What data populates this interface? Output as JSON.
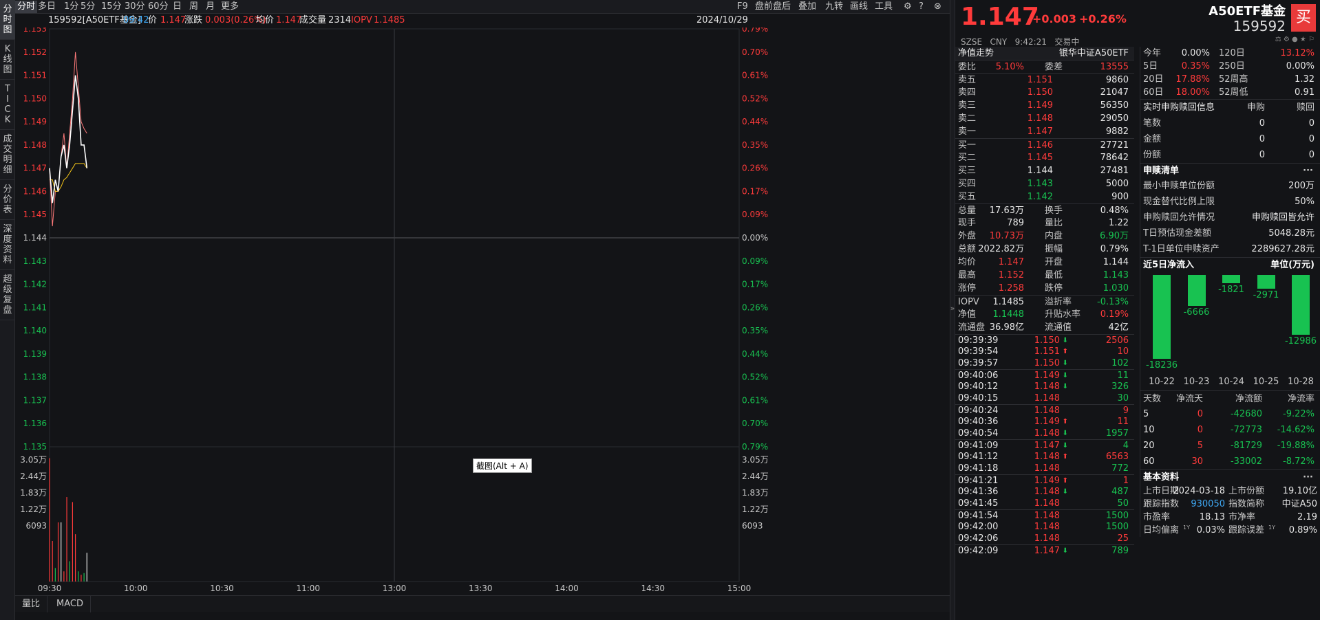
{
  "left_tabs": [
    "分时图",
    "K线图",
    "TICK",
    "成交明细",
    "分价表",
    "深度资料",
    "超级复盘"
  ],
  "toolbar": {
    "periods": [
      "分时",
      "多日",
      "1分",
      "5分",
      "15分",
      "30分",
      "60分",
      "日",
      "周",
      "月",
      "更多"
    ],
    "right_items": [
      "F9",
      "盘前盘后",
      "叠加",
      "九转",
      "画线",
      "工具"
    ],
    "icons": [
      "gear-icon",
      "help-icon",
      "close-icon"
    ]
  },
  "infobar": {
    "code_name": "159592[A50ETF基金]",
    "time": "09:42",
    "price_label": "价",
    "price": "1.147",
    "change_label": "涨跌",
    "change": "0.003(0.26%)",
    "avg_label": "均价",
    "avg": "1.147",
    "vol_label": "成交量",
    "vol": "2314",
    "iopv_label": "IOPV",
    "iopv": "1.1485",
    "date": "2024/10/29"
  },
  "chart_data": {
    "type": "line",
    "prev_close": 1.144,
    "price_ticks": [
      "1.153",
      "1.152",
      "1.151",
      "1.150",
      "1.149",
      "1.148",
      "1.147",
      "1.146",
      "1.145",
      "1.144",
      "1.143",
      "1.142",
      "1.141",
      "1.140",
      "1.139",
      "1.138",
      "1.137",
      "1.136",
      "1.135"
    ],
    "pct_ticks": [
      "0.79%",
      "0.70%",
      "0.61%",
      "0.52%",
      "0.44%",
      "0.35%",
      "0.26%",
      "0.17%",
      "0.09%",
      "0.00%",
      "0.09%",
      "0.17%",
      "0.26%",
      "0.35%",
      "0.44%",
      "0.52%",
      "0.61%",
      "0.70%",
      "0.79%"
    ],
    "vol_ticks": [
      "3.05万",
      "2.44万",
      "1.83万",
      "1.22万",
      "6093"
    ],
    "time_ticks": [
      "09:30",
      "10:00",
      "10:30",
      "11:00",
      "13:00",
      "13:30",
      "14:00",
      "14:30",
      "15:00"
    ],
    "price_series": [
      {
        "t": 0,
        "v": 1.147
      },
      {
        "t": 1,
        "v": 1.1455
      },
      {
        "t": 2,
        "v": 1.1465
      },
      {
        "t": 3,
        "v": 1.146
      },
      {
        "t": 4,
        "v": 1.1475
      },
      {
        "t": 5,
        "v": 1.148
      },
      {
        "t": 6,
        "v": 1.147
      },
      {
        "t": 7,
        "v": 1.148
      },
      {
        "t": 8,
        "v": 1.1495
      },
      {
        "t": 9,
        "v": 1.151
      },
      {
        "t": 10,
        "v": 1.15
      },
      {
        "t": 11,
        "v": 1.148
      },
      {
        "t": 12,
        "v": 1.148
      },
      {
        "t": 13,
        "v": 1.147
      }
    ],
    "avg_series": [
      {
        "t": 0,
        "v": 1.1465
      },
      {
        "t": 1,
        "v": 1.1465
      },
      {
        "t": 2,
        "v": 1.146
      },
      {
        "t": 3,
        "v": 1.146
      },
      {
        "t": 4,
        "v": 1.1462
      },
      {
        "t": 5,
        "v": 1.1465
      },
      {
        "t": 6,
        "v": 1.1466
      },
      {
        "t": 7,
        "v": 1.1468
      },
      {
        "t": 8,
        "v": 1.147
      },
      {
        "t": 9,
        "v": 1.1472
      },
      {
        "t": 10,
        "v": 1.1472
      },
      {
        "t": 11,
        "v": 1.1472
      },
      {
        "t": 12,
        "v": 1.1472
      },
      {
        "t": 13,
        "v": 1.147
      }
    ],
    "iopv_series": [
      {
        "t": 0,
        "v": 1.147
      },
      {
        "t": 1,
        "v": 1.1445
      },
      {
        "t": 2,
        "v": 1.146
      },
      {
        "t": 3,
        "v": 1.146
      },
      {
        "t": 4,
        "v": 1.1475
      },
      {
        "t": 5,
        "v": 1.1485
      },
      {
        "t": 6,
        "v": 1.147
      },
      {
        "t": 7,
        "v": 1.1485
      },
      {
        "t": 8,
        "v": 1.15
      },
      {
        "t": 9,
        "v": 1.152
      },
      {
        "t": 10,
        "v": 1.1505
      },
      {
        "t": 11,
        "v": 1.149
      },
      {
        "t": 12,
        "v": 1.1487
      },
      {
        "t": 13,
        "v": 1.1485
      }
    ],
    "volume_series": [
      {
        "t": 0,
        "v": 36500,
        "c": "red"
      },
      {
        "t": 1,
        "v": 12000,
        "c": "red"
      },
      {
        "t": 2,
        "v": 4000,
        "c": "green"
      },
      {
        "t": 3,
        "v": 17500,
        "c": "red"
      },
      {
        "t": 4,
        "v": 17500,
        "c": "white"
      },
      {
        "t": 5,
        "v": 3000,
        "c": "red"
      },
      {
        "t": 6,
        "v": 25000,
        "c": "red"
      },
      {
        "t": 7,
        "v": 6000,
        "c": "green"
      },
      {
        "t": 8,
        "v": 23500,
        "c": "red"
      },
      {
        "t": 9,
        "v": 14000,
        "c": "red"
      },
      {
        "t": 10,
        "v": 3000,
        "c": "green"
      },
      {
        "t": 11,
        "v": 2000,
        "c": "red"
      },
      {
        "t": 12,
        "v": 2500,
        "c": "green"
      },
      {
        "t": 13,
        "v": 8500,
        "c": "white"
      }
    ],
    "volume_max": 36600,
    "session_minutes": 241,
    "colors": {
      "price": "#ffffff",
      "avg": "#f5c518",
      "iopv": "#ff7a7a",
      "grid": "#2a2b30",
      "up": "#ff3b3b",
      "down": "#18c251",
      "neutral": "#e6e6e6"
    }
  },
  "screenshot_tip": "截图(Alt + A)",
  "bottom_tabs": [
    "量比",
    "MACD"
  ],
  "header": {
    "price": "1.147",
    "change": "+0.003",
    "change_pct": "+0.26%",
    "name": "A50ETF基金",
    "code": "159592",
    "buy_label": "买",
    "sub_market": "SZSE",
    "sub_currency": "CNY",
    "sub_time": "9:42:21",
    "sub_status": "交易中"
  },
  "order_book": {
    "title": "净值走势",
    "title_right": "银华中证A50ETF",
    "weibi_label": "委比",
    "weibi": "5.10%",
    "weicha_label": "委差",
    "weicha": "13555",
    "asks": [
      {
        "label": "卖五",
        "price": "1.151",
        "vol": "9860"
      },
      {
        "label": "卖四",
        "price": "1.150",
        "vol": "21047"
      },
      {
        "label": "卖三",
        "price": "1.149",
        "vol": "56350"
      },
      {
        "label": "卖二",
        "price": "1.148",
        "vol": "29050"
      },
      {
        "label": "卖一",
        "price": "1.147",
        "vol": "9882"
      }
    ],
    "bids": [
      {
        "label": "买一",
        "price": "1.146",
        "vol": "27721",
        "c": "red"
      },
      {
        "label": "买二",
        "price": "1.145",
        "vol": "78642",
        "c": "red"
      },
      {
        "label": "买三",
        "price": "1.144",
        "vol": "27481",
        "c": "white"
      },
      {
        "label": "买四",
        "price": "1.143",
        "vol": "5000",
        "c": "green"
      },
      {
        "label": "买五",
        "price": "1.142",
        "vol": "900",
        "c": "green"
      }
    ]
  },
  "stats": [
    {
      "l1": "总量",
      "v1": "17.63万",
      "c1": "white",
      "l2": "换手",
      "v2": "0.48%",
      "c2": "white"
    },
    {
      "l1": "现手",
      "v1": "789",
      "c1": "white",
      "l2": "量比",
      "v2": "1.22",
      "c2": "white"
    },
    {
      "l1": "外盘",
      "v1": "10.73万",
      "c1": "red",
      "l2": "内盘",
      "v2": "6.90万",
      "c2": "green"
    },
    {
      "l1": "总额",
      "v1": "2022.82万",
      "c1": "white",
      "l2": "振幅",
      "v2": "0.79%",
      "c2": "white"
    },
    {
      "l1": "均价",
      "v1": "1.147",
      "c1": "red",
      "l2": "开盘",
      "v2": "1.144",
      "c2": "white"
    },
    {
      "l1": "最高",
      "v1": "1.152",
      "c1": "red",
      "l2": "最低",
      "v2": "1.143",
      "c2": "green"
    },
    {
      "l1": "涨停",
      "v1": "1.258",
      "c1": "red",
      "l2": "跌停",
      "v2": "1.030",
      "c2": "green"
    }
  ],
  "stats2": [
    {
      "l1": "IOPV",
      "v1": "1.1485",
      "c1": "white",
      "l2": "溢折率",
      "v2": "-0.13%",
      "c2": "green"
    },
    {
      "l1": "净值",
      "v1": "1.1448",
      "c1": "green",
      "l2": "升贴水率",
      "v2": "0.19%",
      "c2": "red"
    },
    {
      "l1": "流通盘",
      "v1": "36.98亿",
      "c1": "white",
      "l2": "流通值",
      "v2": "42亿",
      "c2": "white"
    }
  ],
  "ticks": [
    {
      "time": "09:39:39",
      "price": "1.150",
      "dir": "down",
      "vol": "2506",
      "vc": "red",
      "pc": "red"
    },
    {
      "time": "09:39:54",
      "price": "1.151",
      "dir": "up",
      "vol": "10",
      "vc": "red",
      "pc": "red"
    },
    {
      "time": "09:39:57",
      "price": "1.150",
      "dir": "down",
      "vol": "102",
      "vc": "green",
      "pc": "red"
    },
    {
      "time": "09:40:06",
      "price": "1.149",
      "dir": "down",
      "vol": "11",
      "vc": "green",
      "pc": "red"
    },
    {
      "time": "09:40:12",
      "price": "1.148",
      "dir": "down",
      "vol": "326",
      "vc": "green",
      "pc": "red"
    },
    {
      "time": "09:40:15",
      "price": "1.148",
      "dir": "",
      "vol": "30",
      "vc": "green",
      "pc": "red"
    },
    {
      "time": "09:40:24",
      "price": "1.148",
      "dir": "",
      "vol": "9",
      "vc": "red",
      "pc": "red"
    },
    {
      "time": "09:40:36",
      "price": "1.149",
      "dir": "up",
      "vol": "11",
      "vc": "red",
      "pc": "red"
    },
    {
      "time": "09:40:54",
      "price": "1.148",
      "dir": "down",
      "vol": "1957",
      "vc": "green",
      "pc": "red"
    },
    {
      "time": "09:41:09",
      "price": "1.147",
      "dir": "down",
      "vol": "4",
      "vc": "green",
      "pc": "red"
    },
    {
      "time": "09:41:12",
      "price": "1.148",
      "dir": "up",
      "vol": "6563",
      "vc": "red",
      "pc": "red"
    },
    {
      "time": "09:41:18",
      "price": "1.148",
      "dir": "",
      "vol": "772",
      "vc": "green",
      "pc": "red"
    },
    {
      "time": "09:41:21",
      "price": "1.149",
      "dir": "up",
      "vol": "1",
      "vc": "red",
      "pc": "red"
    },
    {
      "time": "09:41:36",
      "price": "1.148",
      "dir": "down",
      "vol": "487",
      "vc": "green",
      "pc": "red"
    },
    {
      "time": "09:41:45",
      "price": "1.148",
      "dir": "",
      "vol": "50",
      "vc": "green",
      "pc": "red"
    },
    {
      "time": "09:41:54",
      "price": "1.148",
      "dir": "",
      "vol": "1500",
      "vc": "green",
      "pc": "red"
    },
    {
      "time": "09:42:00",
      "price": "1.148",
      "dir": "",
      "vol": "1500",
      "vc": "green",
      "pc": "red"
    },
    {
      "time": "09:42:06",
      "price": "1.148",
      "dir": "",
      "vol": "25",
      "vc": "red",
      "pc": "red"
    },
    {
      "time": "09:42:09",
      "price": "1.147",
      "dir": "down",
      "vol": "789",
      "vc": "green",
      "pc": "red"
    }
  ],
  "returns": [
    {
      "l1": "今年",
      "v1": "0.00%",
      "c1": "white",
      "l2": "120日",
      "v2": "13.12%",
      "c2": "red"
    },
    {
      "l1": "5日",
      "v1": "0.35%",
      "c1": "red",
      "l2": "250日",
      "v2": "0.00%",
      "c2": "white"
    },
    {
      "l1": "20日",
      "v1": "17.88%",
      "c1": "red",
      "l2": "52周高",
      "v2": "1.32",
      "c2": "white"
    },
    {
      "l1": "60日",
      "v1": "18.00%",
      "c1": "red",
      "l2": "52周低",
      "v2": "0.91",
      "c2": "white"
    }
  ],
  "redemption": {
    "title": "实时申购赎回信息",
    "col1": "申购",
    "col2": "赎回",
    "rows": [
      {
        "label": "笔数",
        "v1": "0",
        "v2": "0"
      },
      {
        "label": "金额",
        "v1": "0",
        "v2": "0"
      },
      {
        "label": "份额",
        "v1": "0",
        "v2": "0"
      }
    ]
  },
  "subscription_list": {
    "title": "申赎清单",
    "more": "···",
    "rows": [
      {
        "label": "最小申赎单位份额",
        "value": "200万"
      },
      {
        "label": "现金替代比例上限",
        "value": "50%"
      },
      {
        "label": "申购赎回允许情况",
        "value": "申购赎回皆允许"
      },
      {
        "label": "T日预估现金差额",
        "value": "5048.28元"
      },
      {
        "label": "T-1日单位申赎资产",
        "value": "2289627.28元"
      }
    ]
  },
  "inflow": {
    "title": "近5日净流入",
    "unit": "单位(万元)",
    "bars": [
      {
        "date": "10-22",
        "value": -18236
      },
      {
        "date": "10-23",
        "value": -6666
      },
      {
        "date": "10-24",
        "value": -1821
      },
      {
        "date": "10-25",
        "value": -2971
      },
      {
        "date": "10-28",
        "value": -12986
      }
    ],
    "bar_color": "#18c251",
    "table_headers": [
      "天数",
      "净流天",
      "净流额",
      "净流率"
    ],
    "table_rows": [
      {
        "days": "5",
        "net_days": "0",
        "nd_c": "red",
        "amount": "-42680",
        "rate": "-9.22%"
      },
      {
        "days": "10",
        "net_days": "0",
        "nd_c": "red",
        "amount": "-72773",
        "rate": "-14.62%"
      },
      {
        "days": "20",
        "net_days": "5",
        "nd_c": "red",
        "amount": "-81729",
        "rate": "-19.88%"
      },
      {
        "days": "60",
        "net_days": "30",
        "nd_c": "red",
        "amount": "-33002",
        "rate": "-8.72%"
      }
    ]
  },
  "basic_info": {
    "title": "基本资料",
    "more": "···",
    "rows": [
      {
        "l1": "上市日期",
        "v1": "2024-03-18",
        "c1": "white",
        "l2": "上市份额",
        "v2": "19.10亿",
        "c2": "white"
      },
      {
        "l1": "跟踪指数",
        "v1": "930050",
        "c1": "blue",
        "l2": "指数简称",
        "v2": "中证A50",
        "c2": "white"
      },
      {
        "l1": "市盈率",
        "v1": "18.13",
        "c1": "white",
        "l2": "市净率",
        "v2": "2.19",
        "c2": "white"
      },
      {
        "l1": "日均偏离",
        "sup1": "1Y",
        "v1": "0.03%",
        "c1": "white",
        "l2": "跟踪误差",
        "sup2": "1Y",
        "v2": "0.89%",
        "c2": "white"
      }
    ]
  }
}
